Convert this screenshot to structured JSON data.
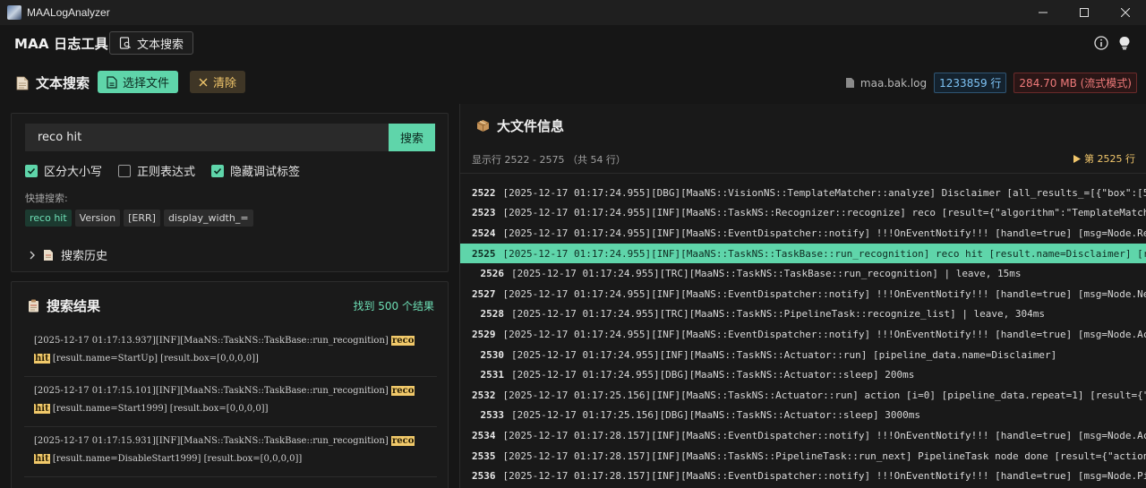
{
  "window": {
    "title": "MAALogAnalyzer"
  },
  "header": {
    "brand": "MAA 日志工具",
    "tab_label": "文本搜索"
  },
  "toolbar": {
    "title": "文本搜索",
    "select_file_label": "选择文件",
    "clear_label": "清除",
    "file_name": "maa.bak.log",
    "line_count": "1233859 行",
    "file_size": "284.70 MB (流式模式)"
  },
  "search": {
    "query": "reco hit",
    "button_label": "搜索",
    "options": [
      {
        "label": "区分大小写",
        "checked": true
      },
      {
        "label": "正则表达式",
        "checked": false
      },
      {
        "label": "隐藏调试标签",
        "checked": true
      }
    ],
    "quick_label": "快捷搜索:",
    "quick_tags": [
      "reco hit",
      "Version",
      "[ERR]",
      "display_width_="
    ],
    "history_label": "搜索历史"
  },
  "results": {
    "title": "搜索结果",
    "count_label": "找到 500 个结果",
    "items": [
      {
        "before": "[2025-12-17 01:17:13.937][INF][MaaNS::TaskNS::TaskBase::run_recognition] ",
        "hl1": "reco",
        "hl2": "hit",
        "after": " [result.name=StartUp] [result.box=[0,0,0,0]]"
      },
      {
        "before": "[2025-12-17 01:17:15.101][INF][MaaNS::TaskNS::TaskBase::run_recognition] ",
        "hl1": "reco",
        "hl2": "hit",
        "after": " [result.name=Start1999] [result.box=[0,0,0,0]]"
      },
      {
        "before": "[2025-12-17 01:17:15.931][INF][MaaNS::TaskNS::TaskBase::run_recognition] ",
        "hl1": "reco",
        "hl2": "hit",
        "after": " [result.name=DisableStart1999] [result.box=[0,0,0,0]]"
      }
    ]
  },
  "viewer": {
    "title": "大文件信息",
    "range_label": "显示行 2522 - 2575 （共 54 行）",
    "jump_label": "第 2525 行",
    "current_line": 2525,
    "lines": [
      {
        "num": "2522",
        "text": "[2025-12-17 01:17:24.955][DBG][MaaNS::VisionNS::TemplateMatcher::analyze] Disclaimer [all_results_=[{\"box\":[5"
      },
      {
        "num": "2523",
        "text": "[2025-12-17 01:17:24.955][INF][MaaNS::TaskNS::Recognizer::recognize] reco [result={\"algorithm\":\"TemplateMatch"
      },
      {
        "num": "2524",
        "text": "[2025-12-17 01:17:24.955][INF][MaaNS::EventDispatcher::notify] !!!OnEventNotify!!! [handle=true] [msg=Node.Re"
      },
      {
        "num": "2525",
        "text": "[2025-12-17 01:17:24.955][INF][MaaNS::TaskNS::TaskBase::run_recognition] reco hit [result.name=Disclaimer] [r"
      },
      {
        "num": "2526",
        "text": "[2025-12-17 01:17:24.955][TRC][MaaNS::TaskNS::TaskBase::run_recognition] | leave, 15ms"
      },
      {
        "num": "2527",
        "text": "[2025-12-17 01:17:24.955][INF][MaaNS::EventDispatcher::notify] !!!OnEventNotify!!! [handle=true] [msg=Node.Ne"
      },
      {
        "num": "2528",
        "text": "[2025-12-17 01:17:24.955][TRC][MaaNS::TaskNS::PipelineTask::recognize_list] | leave, 304ms"
      },
      {
        "num": "2529",
        "text": "[2025-12-17 01:17:24.955][INF][MaaNS::EventDispatcher::notify] !!!OnEventNotify!!! [handle=true] [msg=Node.Ac"
      },
      {
        "num": "2530",
        "text": "[2025-12-17 01:17:24.955][INF][MaaNS::TaskNS::Actuator::run] [pipeline_data.name=Disclaimer]"
      },
      {
        "num": "2531",
        "text": "[2025-12-17 01:17:24.955][DBG][MaaNS::TaskNS::Actuator::sleep] 200ms"
      },
      {
        "num": "2532",
        "text": "[2025-12-17 01:17:25.156][INF][MaaNS::TaskNS::Actuator::run] action [i=0] [pipeline_data.repeat=1] [result={\""
      },
      {
        "num": "2533",
        "text": "[2025-12-17 01:17:25.156][DBG][MaaNS::TaskNS::Actuator::sleep] 3000ms"
      },
      {
        "num": "2534",
        "text": "[2025-12-17 01:17:28.157][INF][MaaNS::EventDispatcher::notify] !!!OnEventNotify!!! [handle=true] [msg=Node.Ac"
      },
      {
        "num": "2535",
        "text": "[2025-12-17 01:17:28.157][INF][MaaNS::TaskNS::PipelineTask::run_next] PipelineTask node done [result={\"action"
      },
      {
        "num": "2536",
        "text": "[2025-12-17 01:17:28.157][INF][MaaNS::EventDispatcher::notify] !!!OnEventNotify!!! [handle=true] [msg=Node.Pi"
      }
    ]
  },
  "colors": {
    "accent": "#5fd5aa",
    "warning": "#f1c66b",
    "background": "#161616"
  }
}
